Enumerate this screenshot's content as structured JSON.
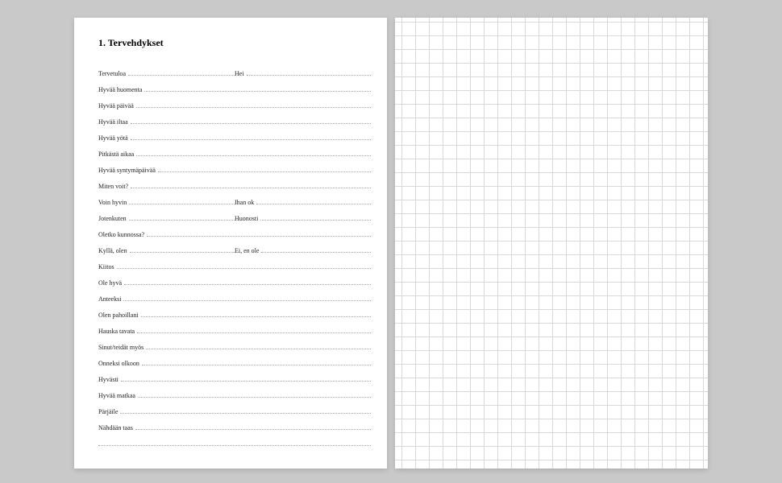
{
  "heading": "1. Tervehdykset",
  "rows": [
    {
      "cells": [
        "Tervetuloa",
        "Hei"
      ]
    },
    {
      "cells": [
        "Hyvää huomenta"
      ]
    },
    {
      "cells": [
        "Hyvää päivää"
      ]
    },
    {
      "cells": [
        "Hyvää iltaa"
      ]
    },
    {
      "cells": [
        "Hyvää yötä"
      ]
    },
    {
      "cells": [
        "Pitkästä aikaa"
      ]
    },
    {
      "cells": [
        "Hyvää syntymäpäivää"
      ]
    },
    {
      "cells": [
        "Miten voit?"
      ]
    },
    {
      "cells": [
        "Voin hyvin",
        "Ihan ok"
      ]
    },
    {
      "cells": [
        "Jotenkuten",
        "Huonosti"
      ]
    },
    {
      "cells": [
        "Oletko kunnossa?"
      ]
    },
    {
      "cells": [
        "Kyllä, olen",
        "Ei, en ole"
      ]
    },
    {
      "cells": [
        "Kiitos"
      ]
    },
    {
      "cells": [
        "Ole hyvä"
      ]
    },
    {
      "cells": [
        "Anteeksi"
      ]
    },
    {
      "cells": [
        "Olen pahoillani"
      ]
    },
    {
      "cells": [
        "Hauska tavata"
      ]
    },
    {
      "cells": [
        "Sinut/teidät myös"
      ]
    },
    {
      "cells": [
        "Onneksi olkoon"
      ]
    },
    {
      "cells": [
        "Hyvästi"
      ]
    },
    {
      "cells": [
        "Hyvää matkaa"
      ]
    },
    {
      "cells": [
        "Pärjäile"
      ]
    },
    {
      "cells": [
        "Nähdään taas"
      ]
    },
    {
      "cells": [
        ""
      ]
    }
  ]
}
